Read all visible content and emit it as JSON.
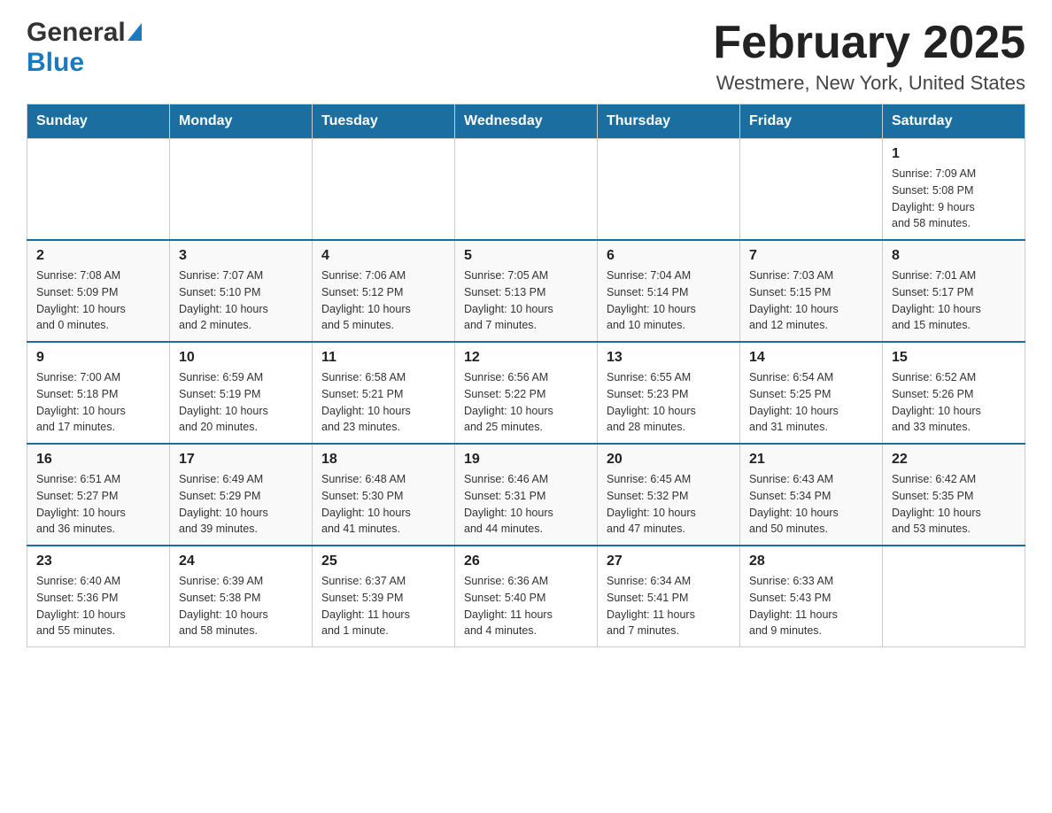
{
  "header": {
    "logo_general": "General",
    "logo_blue": "Blue",
    "month_title": "February 2025",
    "location": "Westmere, New York, United States"
  },
  "days_of_week": [
    "Sunday",
    "Monday",
    "Tuesday",
    "Wednesday",
    "Thursday",
    "Friday",
    "Saturday"
  ],
  "weeks": [
    {
      "days": [
        {
          "number": "",
          "info": ""
        },
        {
          "number": "",
          "info": ""
        },
        {
          "number": "",
          "info": ""
        },
        {
          "number": "",
          "info": ""
        },
        {
          "number": "",
          "info": ""
        },
        {
          "number": "",
          "info": ""
        },
        {
          "number": "1",
          "info": "Sunrise: 7:09 AM\nSunset: 5:08 PM\nDaylight: 9 hours\nand 58 minutes."
        }
      ]
    },
    {
      "days": [
        {
          "number": "2",
          "info": "Sunrise: 7:08 AM\nSunset: 5:09 PM\nDaylight: 10 hours\nand 0 minutes."
        },
        {
          "number": "3",
          "info": "Sunrise: 7:07 AM\nSunset: 5:10 PM\nDaylight: 10 hours\nand 2 minutes."
        },
        {
          "number": "4",
          "info": "Sunrise: 7:06 AM\nSunset: 5:12 PM\nDaylight: 10 hours\nand 5 minutes."
        },
        {
          "number": "5",
          "info": "Sunrise: 7:05 AM\nSunset: 5:13 PM\nDaylight: 10 hours\nand 7 minutes."
        },
        {
          "number": "6",
          "info": "Sunrise: 7:04 AM\nSunset: 5:14 PM\nDaylight: 10 hours\nand 10 minutes."
        },
        {
          "number": "7",
          "info": "Sunrise: 7:03 AM\nSunset: 5:15 PM\nDaylight: 10 hours\nand 12 minutes."
        },
        {
          "number": "8",
          "info": "Sunrise: 7:01 AM\nSunset: 5:17 PM\nDaylight: 10 hours\nand 15 minutes."
        }
      ]
    },
    {
      "days": [
        {
          "number": "9",
          "info": "Sunrise: 7:00 AM\nSunset: 5:18 PM\nDaylight: 10 hours\nand 17 minutes."
        },
        {
          "number": "10",
          "info": "Sunrise: 6:59 AM\nSunset: 5:19 PM\nDaylight: 10 hours\nand 20 minutes."
        },
        {
          "number": "11",
          "info": "Sunrise: 6:58 AM\nSunset: 5:21 PM\nDaylight: 10 hours\nand 23 minutes."
        },
        {
          "number": "12",
          "info": "Sunrise: 6:56 AM\nSunset: 5:22 PM\nDaylight: 10 hours\nand 25 minutes."
        },
        {
          "number": "13",
          "info": "Sunrise: 6:55 AM\nSunset: 5:23 PM\nDaylight: 10 hours\nand 28 minutes."
        },
        {
          "number": "14",
          "info": "Sunrise: 6:54 AM\nSunset: 5:25 PM\nDaylight: 10 hours\nand 31 minutes."
        },
        {
          "number": "15",
          "info": "Sunrise: 6:52 AM\nSunset: 5:26 PM\nDaylight: 10 hours\nand 33 minutes."
        }
      ]
    },
    {
      "days": [
        {
          "number": "16",
          "info": "Sunrise: 6:51 AM\nSunset: 5:27 PM\nDaylight: 10 hours\nand 36 minutes."
        },
        {
          "number": "17",
          "info": "Sunrise: 6:49 AM\nSunset: 5:29 PM\nDaylight: 10 hours\nand 39 minutes."
        },
        {
          "number": "18",
          "info": "Sunrise: 6:48 AM\nSunset: 5:30 PM\nDaylight: 10 hours\nand 41 minutes."
        },
        {
          "number": "19",
          "info": "Sunrise: 6:46 AM\nSunset: 5:31 PM\nDaylight: 10 hours\nand 44 minutes."
        },
        {
          "number": "20",
          "info": "Sunrise: 6:45 AM\nSunset: 5:32 PM\nDaylight: 10 hours\nand 47 minutes."
        },
        {
          "number": "21",
          "info": "Sunrise: 6:43 AM\nSunset: 5:34 PM\nDaylight: 10 hours\nand 50 minutes."
        },
        {
          "number": "22",
          "info": "Sunrise: 6:42 AM\nSunset: 5:35 PM\nDaylight: 10 hours\nand 53 minutes."
        }
      ]
    },
    {
      "days": [
        {
          "number": "23",
          "info": "Sunrise: 6:40 AM\nSunset: 5:36 PM\nDaylight: 10 hours\nand 55 minutes."
        },
        {
          "number": "24",
          "info": "Sunrise: 6:39 AM\nSunset: 5:38 PM\nDaylight: 10 hours\nand 58 minutes."
        },
        {
          "number": "25",
          "info": "Sunrise: 6:37 AM\nSunset: 5:39 PM\nDaylight: 11 hours\nand 1 minute."
        },
        {
          "number": "26",
          "info": "Sunrise: 6:36 AM\nSunset: 5:40 PM\nDaylight: 11 hours\nand 4 minutes."
        },
        {
          "number": "27",
          "info": "Sunrise: 6:34 AM\nSunset: 5:41 PM\nDaylight: 11 hours\nand 7 minutes."
        },
        {
          "number": "28",
          "info": "Sunrise: 6:33 AM\nSunset: 5:43 PM\nDaylight: 11 hours\nand 9 minutes."
        },
        {
          "number": "",
          "info": ""
        }
      ]
    }
  ]
}
